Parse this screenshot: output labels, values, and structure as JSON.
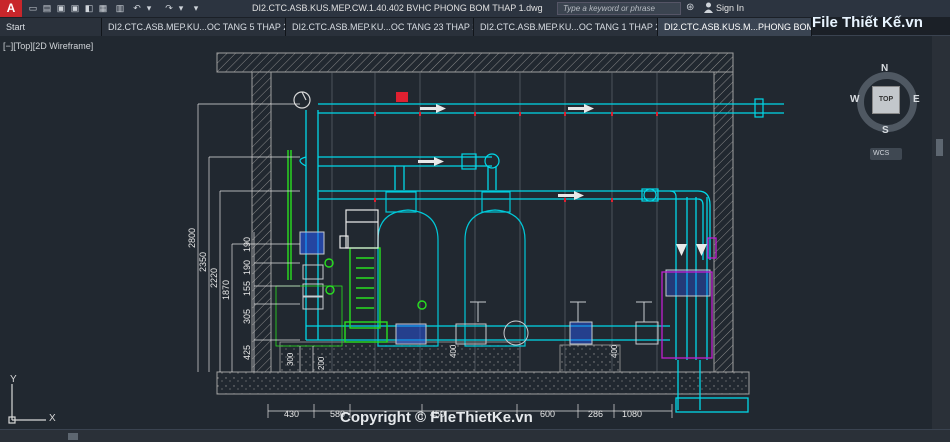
{
  "app": {
    "logo_letter": "A"
  },
  "titlebar": {
    "document_title": "DI2.CTC.ASB.KUS.MEP.CW.1.40.402 BVHC PHONG BOM THAP 1.dwg",
    "search_placeholder": "Type a keyword or phrase",
    "sign_in": "Sign In"
  },
  "tabs": [
    {
      "label": "Start"
    },
    {
      "label": "DI2.CTC.ASB.MEP.KU...OC TANG 5 THAP 2*"
    },
    {
      "label": "DI2.CTC.ASB.MEP.KU...OC TANG 23 THAP 2*"
    },
    {
      "label": "DI2.CTC.ASB.MEP.KU...OC TANG 1 THAP 2*"
    },
    {
      "label": "DI2.CTC.ASB.KUS.M...PHONG BOM THAP"
    }
  ],
  "viewport": {
    "label": "[−][Top][2D Wireframe]"
  },
  "viewcube": {
    "north": "N",
    "south": "S",
    "east": "E",
    "west": "W",
    "face": "TOP",
    "wcs": "WCS"
  },
  "ucs": {
    "x": "X",
    "y": "Y"
  },
  "dimensions": {
    "v2800": "2800",
    "v2350": "2350",
    "v2220": "2220",
    "v1870": "1870",
    "v190a": "190",
    "v190b": "190",
    "v155": "155",
    "v305": "305",
    "v425": "425",
    "v300": "300",
    "v200": "200",
    "v400a": "400",
    "v400b": "400",
    "h430": "430",
    "h580": "580",
    "h450": "450",
    "h600": "600",
    "h286": "286",
    "h1080": "1080"
  },
  "watermark": {
    "logo": "File Thiết Kế.vn",
    "copyright": "Copyright © FileThietKe.vn"
  },
  "colors": {
    "background": "#212830",
    "cyan": "#00d8e8",
    "green": "#28e020",
    "hatch": "#9a9a9a",
    "blue": "#2a5cff",
    "magenta": "#c020d0",
    "red_valve": "#e02030"
  }
}
